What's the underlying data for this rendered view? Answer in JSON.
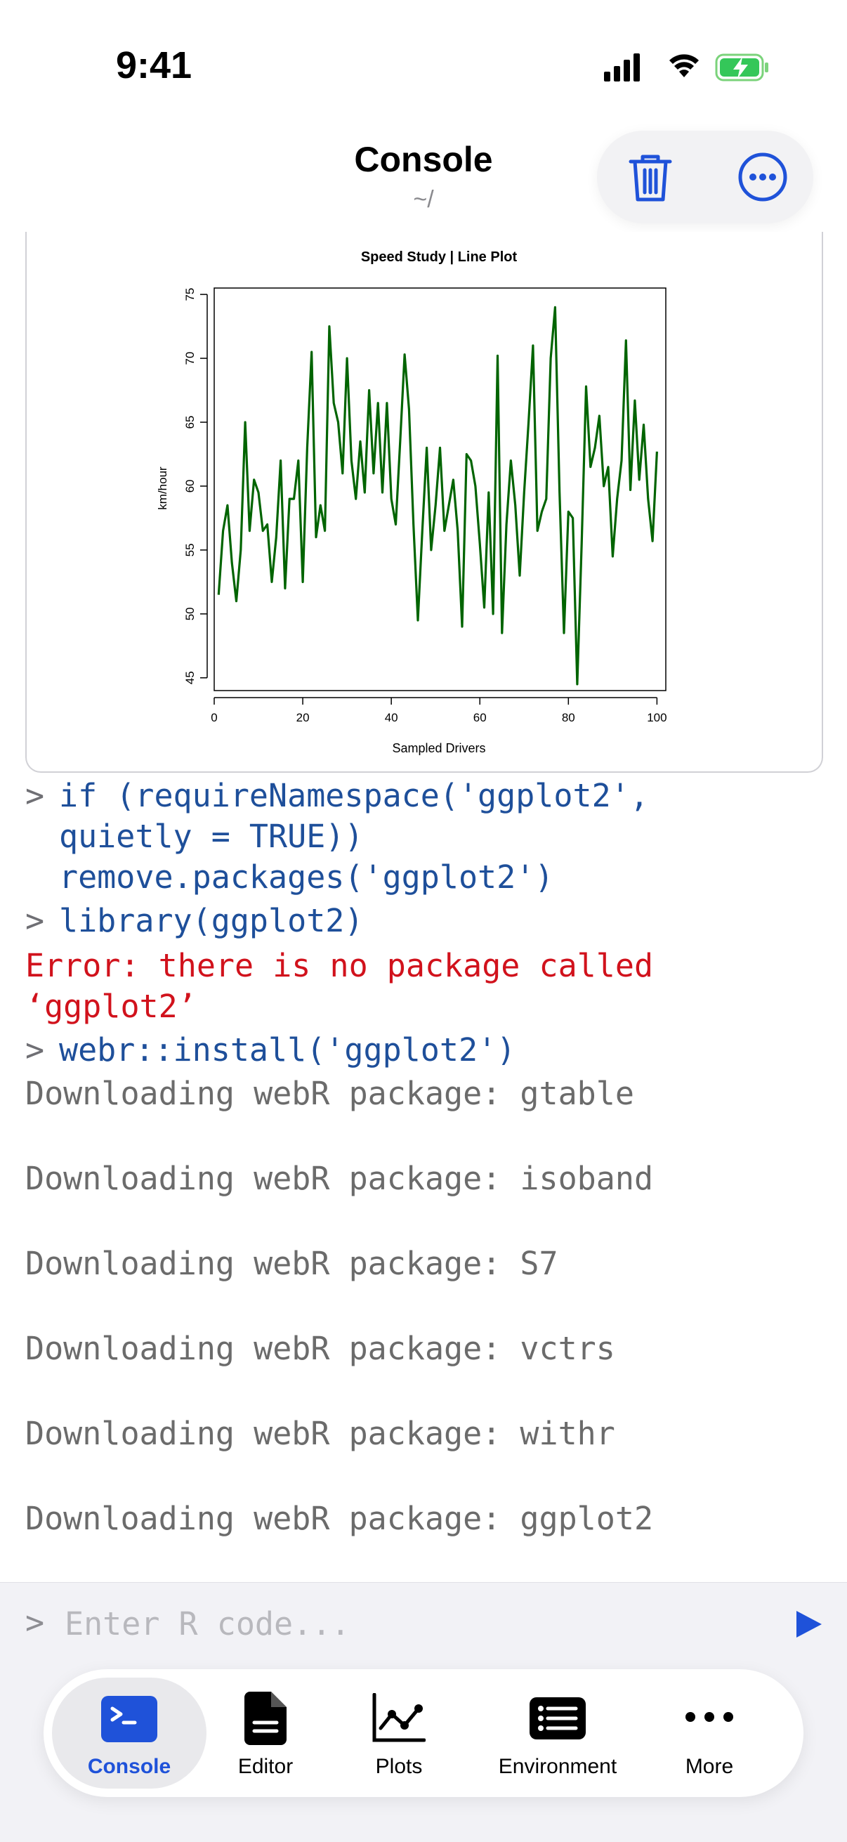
{
  "status_bar": {
    "time": "9:41"
  },
  "header": {
    "title": "Console",
    "subtitle": "~/"
  },
  "plot": {
    "chart_data": {
      "type": "line",
      "title": "Speed Study | Line Plot",
      "xlabel": "Sampled Drivers",
      "ylabel": "km/hour",
      "xlim": [
        0,
        102
      ],
      "ylim": [
        44,
        75.5
      ],
      "x_ticks": [
        0,
        20,
        40,
        60,
        80,
        100
      ],
      "y_ticks": [
        45,
        50,
        55,
        60,
        65,
        70,
        75
      ],
      "grid": false,
      "series": [
        {
          "color": "#006400",
          "x": [
            1,
            2,
            3,
            4,
            5,
            6,
            7,
            8,
            9,
            10,
            11,
            12,
            13,
            14,
            15,
            16,
            17,
            18,
            19,
            20,
            21,
            22,
            23,
            24,
            25,
            26,
            27,
            28,
            29,
            30,
            31,
            32,
            33,
            34,
            35,
            36,
            37,
            38,
            39,
            40,
            41,
            42,
            43,
            44,
            45,
            46,
            47,
            48,
            49,
            50,
            51,
            52,
            53,
            54,
            55,
            56,
            57,
            58,
            59,
            60,
            61,
            62,
            63,
            64,
            65,
            66,
            67,
            68,
            69,
            70,
            71,
            72,
            73,
            74,
            75,
            76,
            77,
            78,
            79,
            80,
            81,
            82,
            83,
            84,
            85,
            86,
            87,
            88,
            89,
            90,
            91,
            92,
            93,
            94,
            95,
            96,
            97,
            98,
            99,
            100
          ],
          "values": [
            51.5,
            56.5,
            58.5,
            54,
            51,
            55,
            65,
            56.5,
            60.5,
            59.5,
            56.5,
            57,
            52.5,
            56,
            62,
            52,
            59,
            59,
            62,
            52.5,
            63,
            70.5,
            56,
            58.5,
            56.5,
            72.5,
            66.5,
            65,
            61,
            70,
            62,
            59,
            63.5,
            59.5,
            67.5,
            61,
            66.5,
            59.5,
            66.5,
            59,
            57,
            63.5,
            70.3,
            66,
            57,
            49.5,
            56.5,
            63,
            55,
            58.5,
            63,
            56.5,
            58.5,
            60.5,
            56.5,
            49,
            62.5,
            62,
            60,
            55.5,
            50.5,
            59.5,
            50,
            70.2,
            48.5,
            57,
            62,
            58.5,
            53,
            59.5,
            65,
            71,
            56.5,
            58,
            59,
            70,
            74,
            59.5,
            48.5,
            58,
            57.5,
            44.5,
            55.5,
            67.8,
            61.5,
            63,
            65.5,
            60,
            61.5,
            54.5,
            59,
            62,
            71.4,
            59.7,
            66.7,
            60.5,
            64.8,
            59,
            55.7,
            62.7
          ]
        }
      ]
    }
  },
  "console": {
    "prompt": ">",
    "cmd1_line1": "if (requireNamespace('ggplot2',",
    "cmd1_line2": "quietly = TRUE))",
    "cmd1_line3": "remove.packages('ggplot2')",
    "cmd2": "library(ggplot2)",
    "error_line1": "Error: there is no package called",
    "error_line2": "‘ggplot2’",
    "cmd3": "webr::install('ggplot2')",
    "messages": [
      "Downloading webR package: gtable",
      "Downloading webR package: isoband",
      "Downloading webR package: S7",
      "Downloading webR package: vctrs",
      "Downloading webR package: withr",
      "Downloading webR package: ggplot2"
    ]
  },
  "input": {
    "prompt": ">",
    "placeholder": "Enter R code..."
  },
  "tabs": [
    {
      "label": "Console",
      "icon": "terminal-icon",
      "active": true
    },
    {
      "label": "Editor",
      "icon": "document-icon",
      "active": false
    },
    {
      "label": "Plots",
      "icon": "line-chart-icon",
      "active": false
    },
    {
      "label": "Environment",
      "icon": "list-icon",
      "active": false
    },
    {
      "label": "More",
      "icon": "ellipsis-icon",
      "active": false
    }
  ],
  "colors": {
    "accent": "#1f52d9",
    "code": "#1e4f9a",
    "error": "#d1121c",
    "series": "#006400"
  }
}
